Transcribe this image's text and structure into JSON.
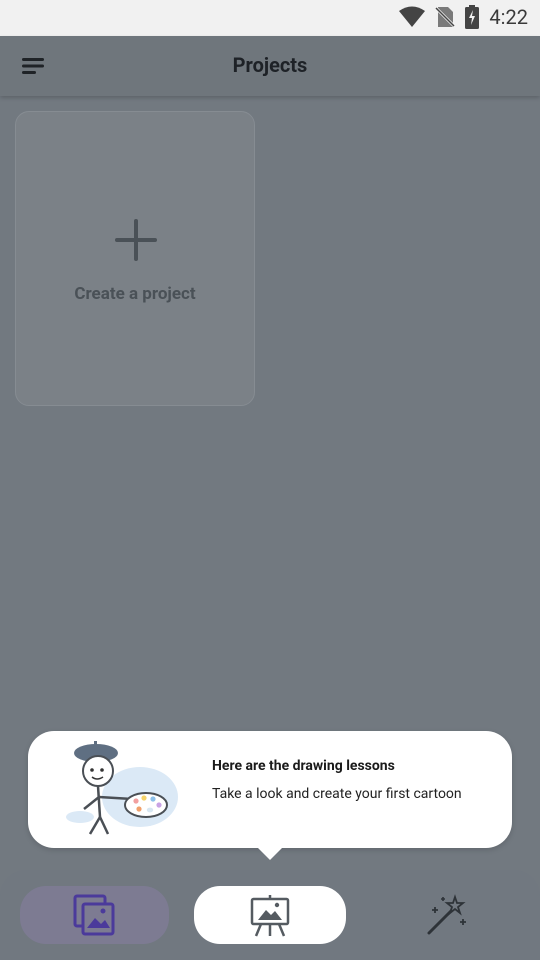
{
  "status_bar": {
    "time": "4:22",
    "icons": [
      "wifi-icon",
      "no-sim-icon",
      "battery-charging-icon"
    ]
  },
  "app_bar": {
    "title": "Projects",
    "menu_icon": "menu-icon"
  },
  "create_card": {
    "label": "Create a project",
    "icon": "plus-icon"
  },
  "tooltip": {
    "title": "Here are the drawing lessons",
    "text": "Take a look and create your first cartoon",
    "illustration": "artist-with-palette"
  },
  "bottom_nav": {
    "tabs": [
      {
        "id": "gallery",
        "icon": "gallery-icon",
        "selected": false
      },
      {
        "id": "lessons",
        "icon": "easel-icon",
        "selected": true
      },
      {
        "id": "magic",
        "icon": "magic-wand-icon",
        "selected": false
      }
    ]
  },
  "colors": {
    "accent": "#5a48b0",
    "overlay": "#727980"
  }
}
